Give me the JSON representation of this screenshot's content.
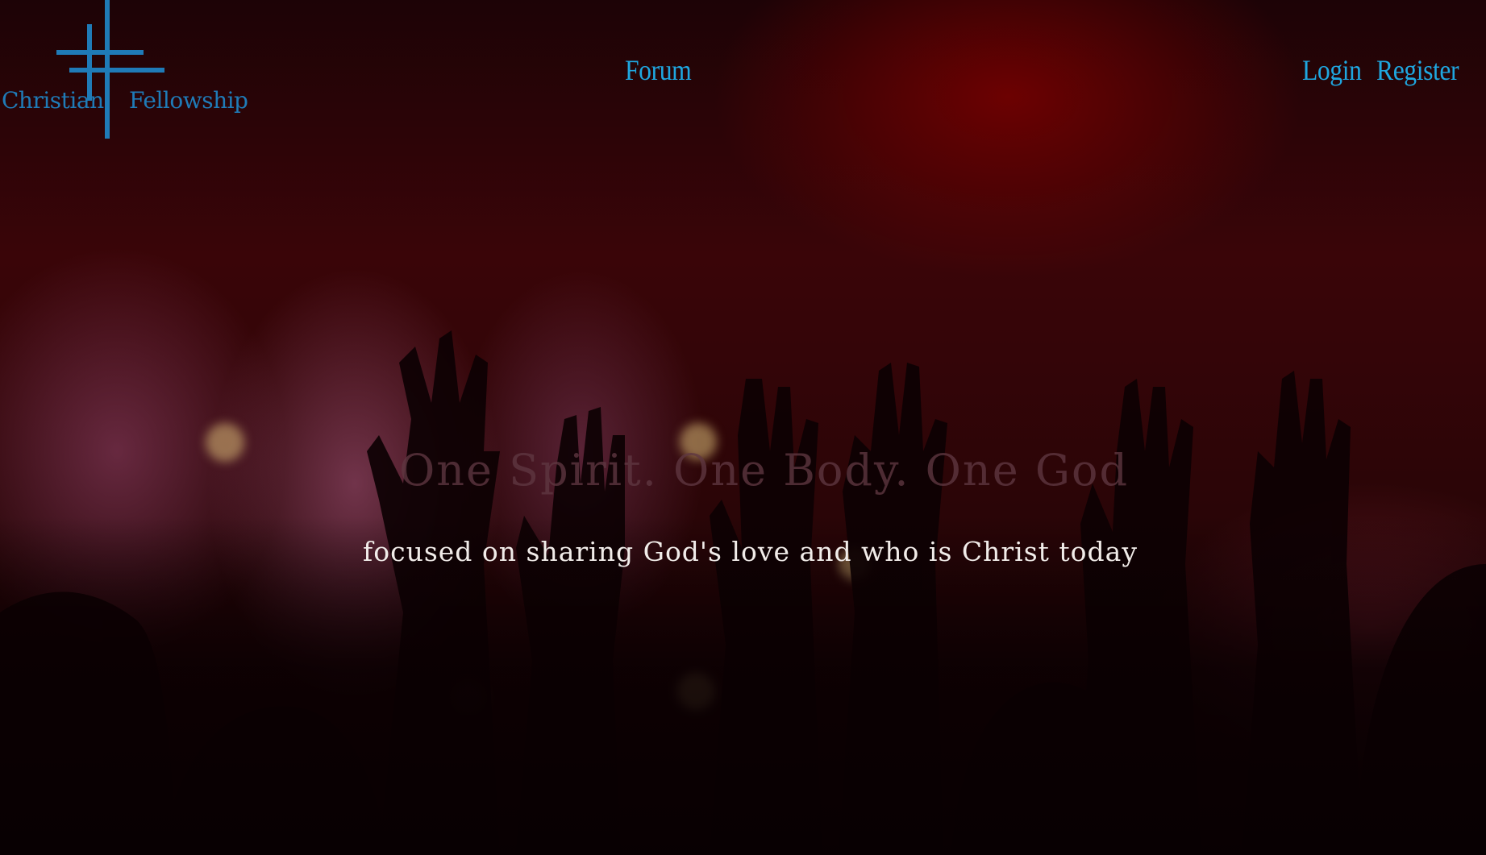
{
  "brand": {
    "logo_left": "Christian",
    "logo_right": "Fellowship",
    "accent_color": "#1f7bb7",
    "icon": "cross-icon"
  },
  "nav": {
    "forum": "Forum",
    "login": "Login",
    "register": "Register",
    "link_color": "#1fa7e0"
  },
  "hero": {
    "title": "One Spirit. One Body. One God",
    "subtitle": "focused on sharing God's love and who is Christ today",
    "background": "worship-crowd-image"
  }
}
